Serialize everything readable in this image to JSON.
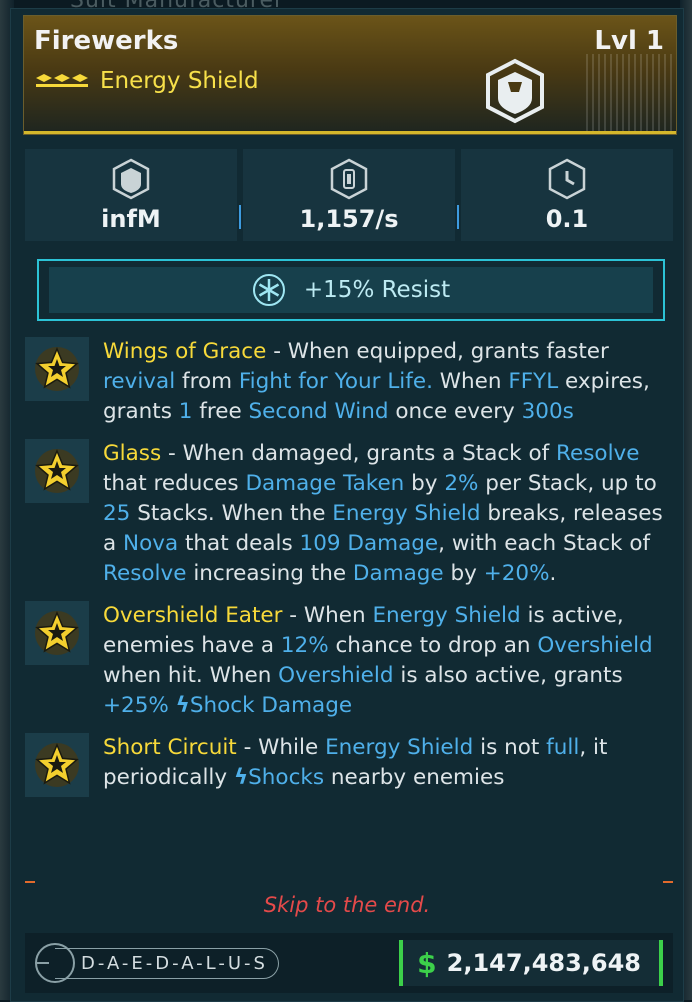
{
  "background": {
    "top_text": "Suit Manufacturer"
  },
  "item": {
    "name": "Firewerks",
    "level": "Lvl 1",
    "type": "Energy Shield",
    "rarity_color": "#d4b72b",
    "icon": "shield-icon"
  },
  "stats": [
    {
      "icon": "shield-capacity-icon",
      "value": "infM"
    },
    {
      "icon": "recharge-rate-icon",
      "value": "1,157/s"
    },
    {
      "icon": "recharge-delay-icon",
      "value": "0.1"
    }
  ],
  "resist": {
    "icon": "cryo-snowflake-icon",
    "label": "+15% Resist",
    "color": "#2cc3d6"
  },
  "perks": [
    {
      "icon": "legendary-star-icon",
      "name": "Wings of Grace",
      "parts": [
        {
          "t": " - When equipped, grants faster "
        },
        {
          "t": "revival",
          "hl": true
        },
        {
          "t": " from "
        },
        {
          "t": "Fight for Your Life.",
          "hl": true
        },
        {
          "t": " When "
        },
        {
          "t": "FFYL",
          "hl": true
        },
        {
          "t": " expires, grants "
        },
        {
          "t": "1",
          "hl": true
        },
        {
          "t": " free "
        },
        {
          "t": "Second Wind",
          "hl": true
        },
        {
          "t": " once every "
        },
        {
          "t": "300s",
          "hl": true
        }
      ]
    },
    {
      "icon": "legendary-star-icon",
      "name": "Glass",
      "parts": [
        {
          "t": " - When damaged, grants a Stack of "
        },
        {
          "t": "Resolve",
          "hl": true
        },
        {
          "t": " that reduces "
        },
        {
          "t": "Damage Taken",
          "hl": true
        },
        {
          "t": " by "
        },
        {
          "t": "2%",
          "hl": true
        },
        {
          "t": " per Stack, up to "
        },
        {
          "t": "25",
          "hl": true
        },
        {
          "t": " Stacks. When the "
        },
        {
          "t": "Energy Shield",
          "hl": true
        },
        {
          "t": " breaks, releases a "
        },
        {
          "t": "Nova",
          "hl": true
        },
        {
          "t": " that deals "
        },
        {
          "t": "109 Damage",
          "hl": true
        },
        {
          "t": ", with each Stack of "
        },
        {
          "t": "Resolve",
          "hl": true
        },
        {
          "t": " increasing the "
        },
        {
          "t": "Damage",
          "hl": true
        },
        {
          "t": " by "
        },
        {
          "t": "+20%",
          "hl": true
        },
        {
          "t": "."
        }
      ]
    },
    {
      "icon": "legendary-star-icon",
      "name": "Overshield Eater",
      "parts": [
        {
          "t": " - When "
        },
        {
          "t": "Energy Shield",
          "hl": true
        },
        {
          "t": " is active, enemies have a "
        },
        {
          "t": "12%",
          "hl": true
        },
        {
          "t": " chance to drop an "
        },
        {
          "t": "Overshield",
          "hl": true
        },
        {
          "t": " when hit. When "
        },
        {
          "t": "Overshield",
          "hl": true
        },
        {
          "t": " is also active, grants "
        },
        {
          "t": "+25% ",
          "hl": true
        },
        {
          "t": "ϟ",
          "bolt": true
        },
        {
          "t": "Shock Damage",
          "hl": true
        }
      ]
    },
    {
      "icon": "legendary-star-icon",
      "name": "Short Circuit",
      "parts": [
        {
          "t": " - While "
        },
        {
          "t": "Energy Shield",
          "hl": true
        },
        {
          "t": " is not "
        },
        {
          "t": "full",
          "hl": true
        },
        {
          "t": ", it periodically "
        },
        {
          "t": "ϟ",
          "bolt": true
        },
        {
          "t": "Shocks",
          "hl": true
        },
        {
          "t": " nearby enemies"
        }
      ]
    }
  ],
  "footer_note": "Skip to the end.",
  "footer": {
    "manufacturer": "D-A-E-D-A-L-U-S",
    "currency_icon": "dollar-icon",
    "currency_symbol": "$",
    "money": "2,147,483,648"
  },
  "colors": {
    "highlight": "#4fb0ea",
    "perk_name": "#f7d93a",
    "money": "#3cd04a",
    "warning": "#e44a4a"
  }
}
